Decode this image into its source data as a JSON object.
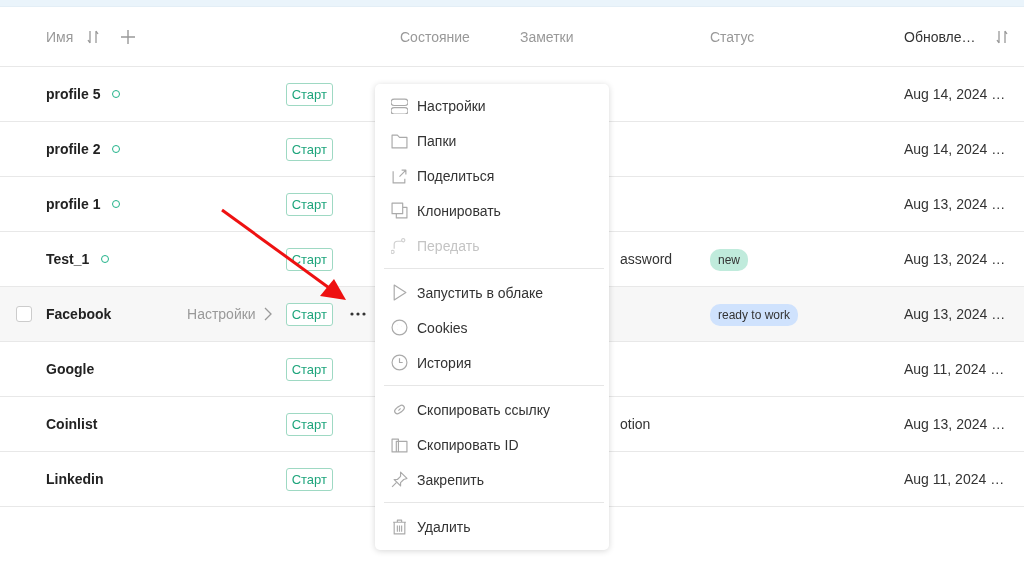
{
  "table": {
    "columns": [
      {
        "label": "Имя",
        "sortable": true,
        "addable": true
      },
      {
        "label": "Состояние",
        "sortable": false,
        "addable": false
      },
      {
        "label": "Заметки",
        "sortable": false,
        "addable": false
      },
      {
        "label": "Статус",
        "sortable": false,
        "addable": false
      },
      {
        "label": "Обновле…",
        "sortable": true,
        "addable": false
      }
    ],
    "rows": [
      {
        "name": "profile 5",
        "online": true,
        "hovered": false,
        "start": "Старт",
        "updated": "Aug 14, 2024 …"
      },
      {
        "name": "profile 2",
        "online": true,
        "hovered": false,
        "start": "Старт",
        "updated": "Aug 14, 2024 …"
      },
      {
        "name": "profile 1",
        "online": true,
        "hovered": false,
        "start": "Старт",
        "updated": "Aug 13, 2024 …"
      },
      {
        "name": "Test_1",
        "online": true,
        "hovered": false,
        "start": "Старт",
        "note": "assword",
        "tag": {
          "label": "new",
          "color": "#c0ebdc"
        },
        "updated": "Aug 13, 2024 …"
      },
      {
        "name": "Facebook",
        "online": false,
        "hovered": true,
        "checked": false,
        "settings": "Настройки",
        "start": "Старт",
        "tag": {
          "label": "ready to work",
          "color": "#cfe2fd"
        },
        "updated": "Aug 13, 2024 …"
      },
      {
        "name": "Google",
        "online": false,
        "hovered": false,
        "start": "Старт",
        "updated": "Aug 11, 2024 …"
      },
      {
        "name": "Coinlist",
        "online": false,
        "hovered": false,
        "start": "Старт",
        "note": "otion",
        "updated": "Aug 13, 2024 …"
      },
      {
        "name": "Linkedin",
        "online": false,
        "hovered": false,
        "start": "Старт",
        "updated": "Aug 11, 2024 …"
      }
    ]
  },
  "context_menu": {
    "groups": [
      [
        {
          "label": "Настройки",
          "disabled": false
        },
        {
          "label": "Папки",
          "disabled": false
        },
        {
          "label": "Поделиться",
          "disabled": false
        },
        {
          "label": "Клонировать",
          "disabled": false
        },
        {
          "label": "Передать",
          "disabled": true
        }
      ],
      [
        {
          "label": "Запустить в облаке",
          "disabled": false
        },
        {
          "label": "Cookies",
          "disabled": false
        },
        {
          "label": "История",
          "disabled": false
        }
      ],
      [
        {
          "label": "Скопировать ссылку",
          "disabled": false
        },
        {
          "label": "Скопировать ID",
          "disabled": false
        },
        {
          "label": "Закрепить",
          "disabled": false
        }
      ],
      [
        {
          "label": "Удалить",
          "disabled": false
        }
      ]
    ]
  }
}
